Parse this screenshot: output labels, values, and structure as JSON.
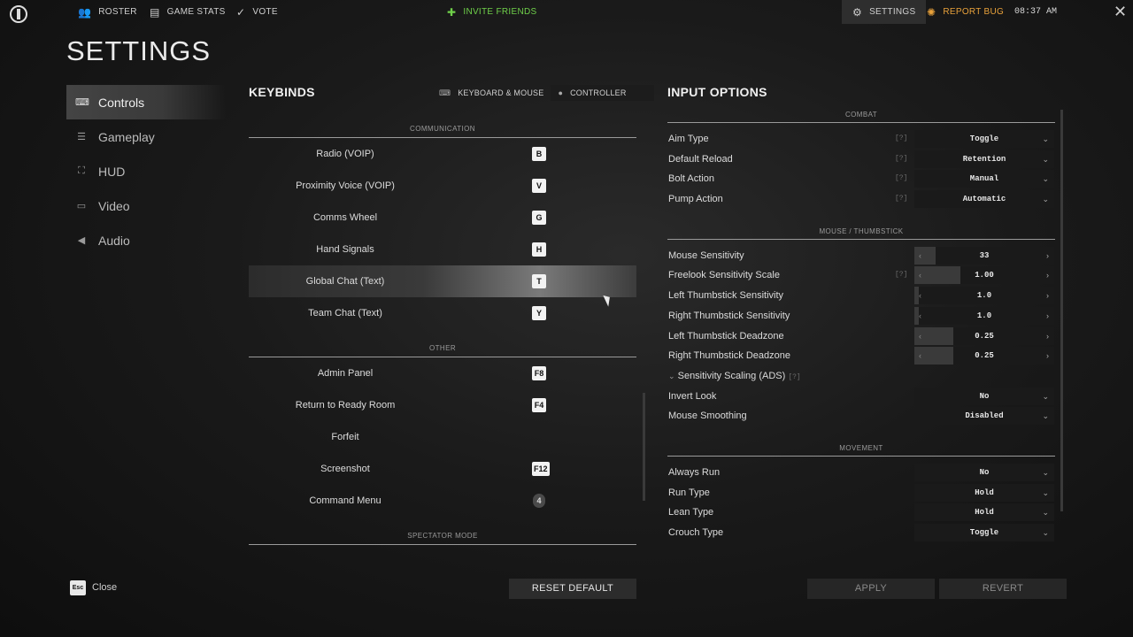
{
  "topbar": {
    "roster": "ROSTER",
    "game_stats": "GAME STATS",
    "vote": "VOTE",
    "invite_friends": "INVITE FRIENDS",
    "settings": "SETTINGS",
    "report_bug": "REPORT BUG",
    "clock": "08:37 AM"
  },
  "page_title": "SETTINGS",
  "sidebar": {
    "items": [
      {
        "label": "Controls",
        "icon": "keyboard-icon",
        "active": true
      },
      {
        "label": "Gameplay",
        "icon": "sliders-icon",
        "active": false
      },
      {
        "label": "HUD",
        "icon": "hud-frame-icon",
        "active": false
      },
      {
        "label": "Video",
        "icon": "monitor-icon",
        "active": false
      },
      {
        "label": "Audio",
        "icon": "speaker-icon",
        "active": false
      }
    ]
  },
  "keybinds": {
    "title": "KEYBINDS",
    "tabs": {
      "keyboard_mouse": "KEYBOARD & MOUSE",
      "controller": "CONTROLLER"
    },
    "sections": {
      "communication": "COMMUNICATION",
      "other": "OTHER",
      "spectator": "SPECTATOR MODE"
    },
    "communication_rows": [
      {
        "label": "Radio (VOIP)",
        "key": "B"
      },
      {
        "label": "Proximity Voice (VOIP)",
        "key": "V"
      },
      {
        "label": "Comms Wheel",
        "key": "G"
      },
      {
        "label": "Hand Signals",
        "key": "H"
      },
      {
        "label": "Global Chat (Text)",
        "key": "T"
      },
      {
        "label": "Team Chat (Text)",
        "key": "Y"
      }
    ],
    "other_rows": [
      {
        "label": "Admin Panel",
        "key": "F8"
      },
      {
        "label": "Return to Ready Room",
        "key": "F4"
      },
      {
        "label": "Forfeit",
        "key": ""
      },
      {
        "label": "Screenshot",
        "key": "F12"
      },
      {
        "label": "Command Menu",
        "key": "4"
      }
    ]
  },
  "input_options": {
    "title": "INPUT OPTIONS",
    "sections": {
      "combat": "COMBAT",
      "mouse": "MOUSE / THUMBSTICK",
      "movement": "MOVEMENT"
    },
    "help": "[?]",
    "combat": [
      {
        "label": "Aim Type",
        "value": "Toggle"
      },
      {
        "label": "Default Reload",
        "value": "Retention"
      },
      {
        "label": "Bolt Action",
        "value": "Manual"
      },
      {
        "label": "Pump Action",
        "value": "Automatic"
      }
    ],
    "mouse": [
      {
        "label": "Mouse Sensitivity",
        "value": "33",
        "fill": 0.15
      },
      {
        "label": "Freelook Sensitivity Scale",
        "value": "1.00",
        "fill": 0.33
      },
      {
        "label": "Left Thumbstick Sensitivity",
        "value": "1.0",
        "fill": 0.03
      },
      {
        "label": "Right Thumbstick Sensitivity",
        "value": "1.0",
        "fill": 0.03
      },
      {
        "label": "Left Thumbstick Deadzone",
        "value": "0.25",
        "fill": 0.28
      },
      {
        "label": "Right Thumbstick Deadzone",
        "value": "0.25",
        "fill": 0.28
      }
    ],
    "sensitivity_scaling": "Sensitivity Scaling (ADS)",
    "mouse_dropdowns": [
      {
        "label": "Invert Look",
        "value": "No"
      },
      {
        "label": "Mouse Smoothing",
        "value": "Disabled"
      }
    ],
    "movement": [
      {
        "label": "Always Run",
        "value": "No"
      },
      {
        "label": "Run Type",
        "value": "Hold"
      },
      {
        "label": "Lean Type",
        "value": "Hold"
      },
      {
        "label": "Crouch Type",
        "value": "Toggle"
      }
    ]
  },
  "bottom": {
    "esc": "Esc",
    "close": "Close",
    "reset_default": "RESET DEFAULT",
    "apply": "APPLY",
    "revert": "REVERT"
  }
}
